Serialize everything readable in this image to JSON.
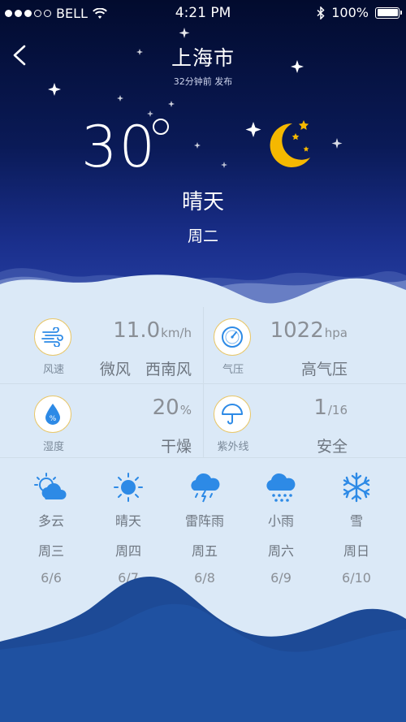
{
  "status_bar": {
    "carrier": "BELL",
    "time": "4:21 PM",
    "battery": "100%",
    "battery_level": 1.0,
    "signal_bars": 3,
    "signal_total": 5
  },
  "header": {
    "city": "上海市",
    "updated": "32分钟前 发布"
  },
  "current": {
    "temperature": "30",
    "condition": "晴天",
    "weekday": "周二",
    "icon": "moon-with-stars-icon"
  },
  "details": {
    "wind": {
      "label": "风速",
      "value": "11.0",
      "unit": "km/h",
      "level": "微风",
      "direction": "西南风",
      "icon": "wind-icon"
    },
    "pressure": {
      "label": "气压",
      "value": "1022",
      "unit": "hpa",
      "desc": "高气压",
      "icon": "barometer-icon"
    },
    "humidity": {
      "label": "湿度",
      "value": "20",
      "unit": "%",
      "desc": "干燥",
      "icon": "humidity-drop-icon"
    },
    "uv": {
      "label": "紫外线",
      "value": "1",
      "unit": "/16",
      "desc": "安全",
      "icon": "umbrella-icon"
    }
  },
  "forecast": [
    {
      "condition": "多云",
      "weekday": "周三",
      "date": "6/6",
      "icon": "partly-cloudy-icon"
    },
    {
      "condition": "晴天",
      "weekday": "周四",
      "date": "6/7",
      "icon": "sun-icon"
    },
    {
      "condition": "雷阵雨",
      "weekday": "周五",
      "date": "6/8",
      "icon": "thunderstorm-icon"
    },
    {
      "condition": "小雨",
      "weekday": "周六",
      "date": "6/9",
      "icon": "light-rain-icon"
    },
    {
      "condition": "雪",
      "weekday": "周日",
      "date": "6/10",
      "icon": "snowflake-icon"
    }
  ],
  "colors": {
    "accent_blue": "#2d8ae6",
    "moon_yellow": "#f5b800",
    "sky_dark": "#020b2e",
    "hill_blue": "#1d4a96"
  }
}
